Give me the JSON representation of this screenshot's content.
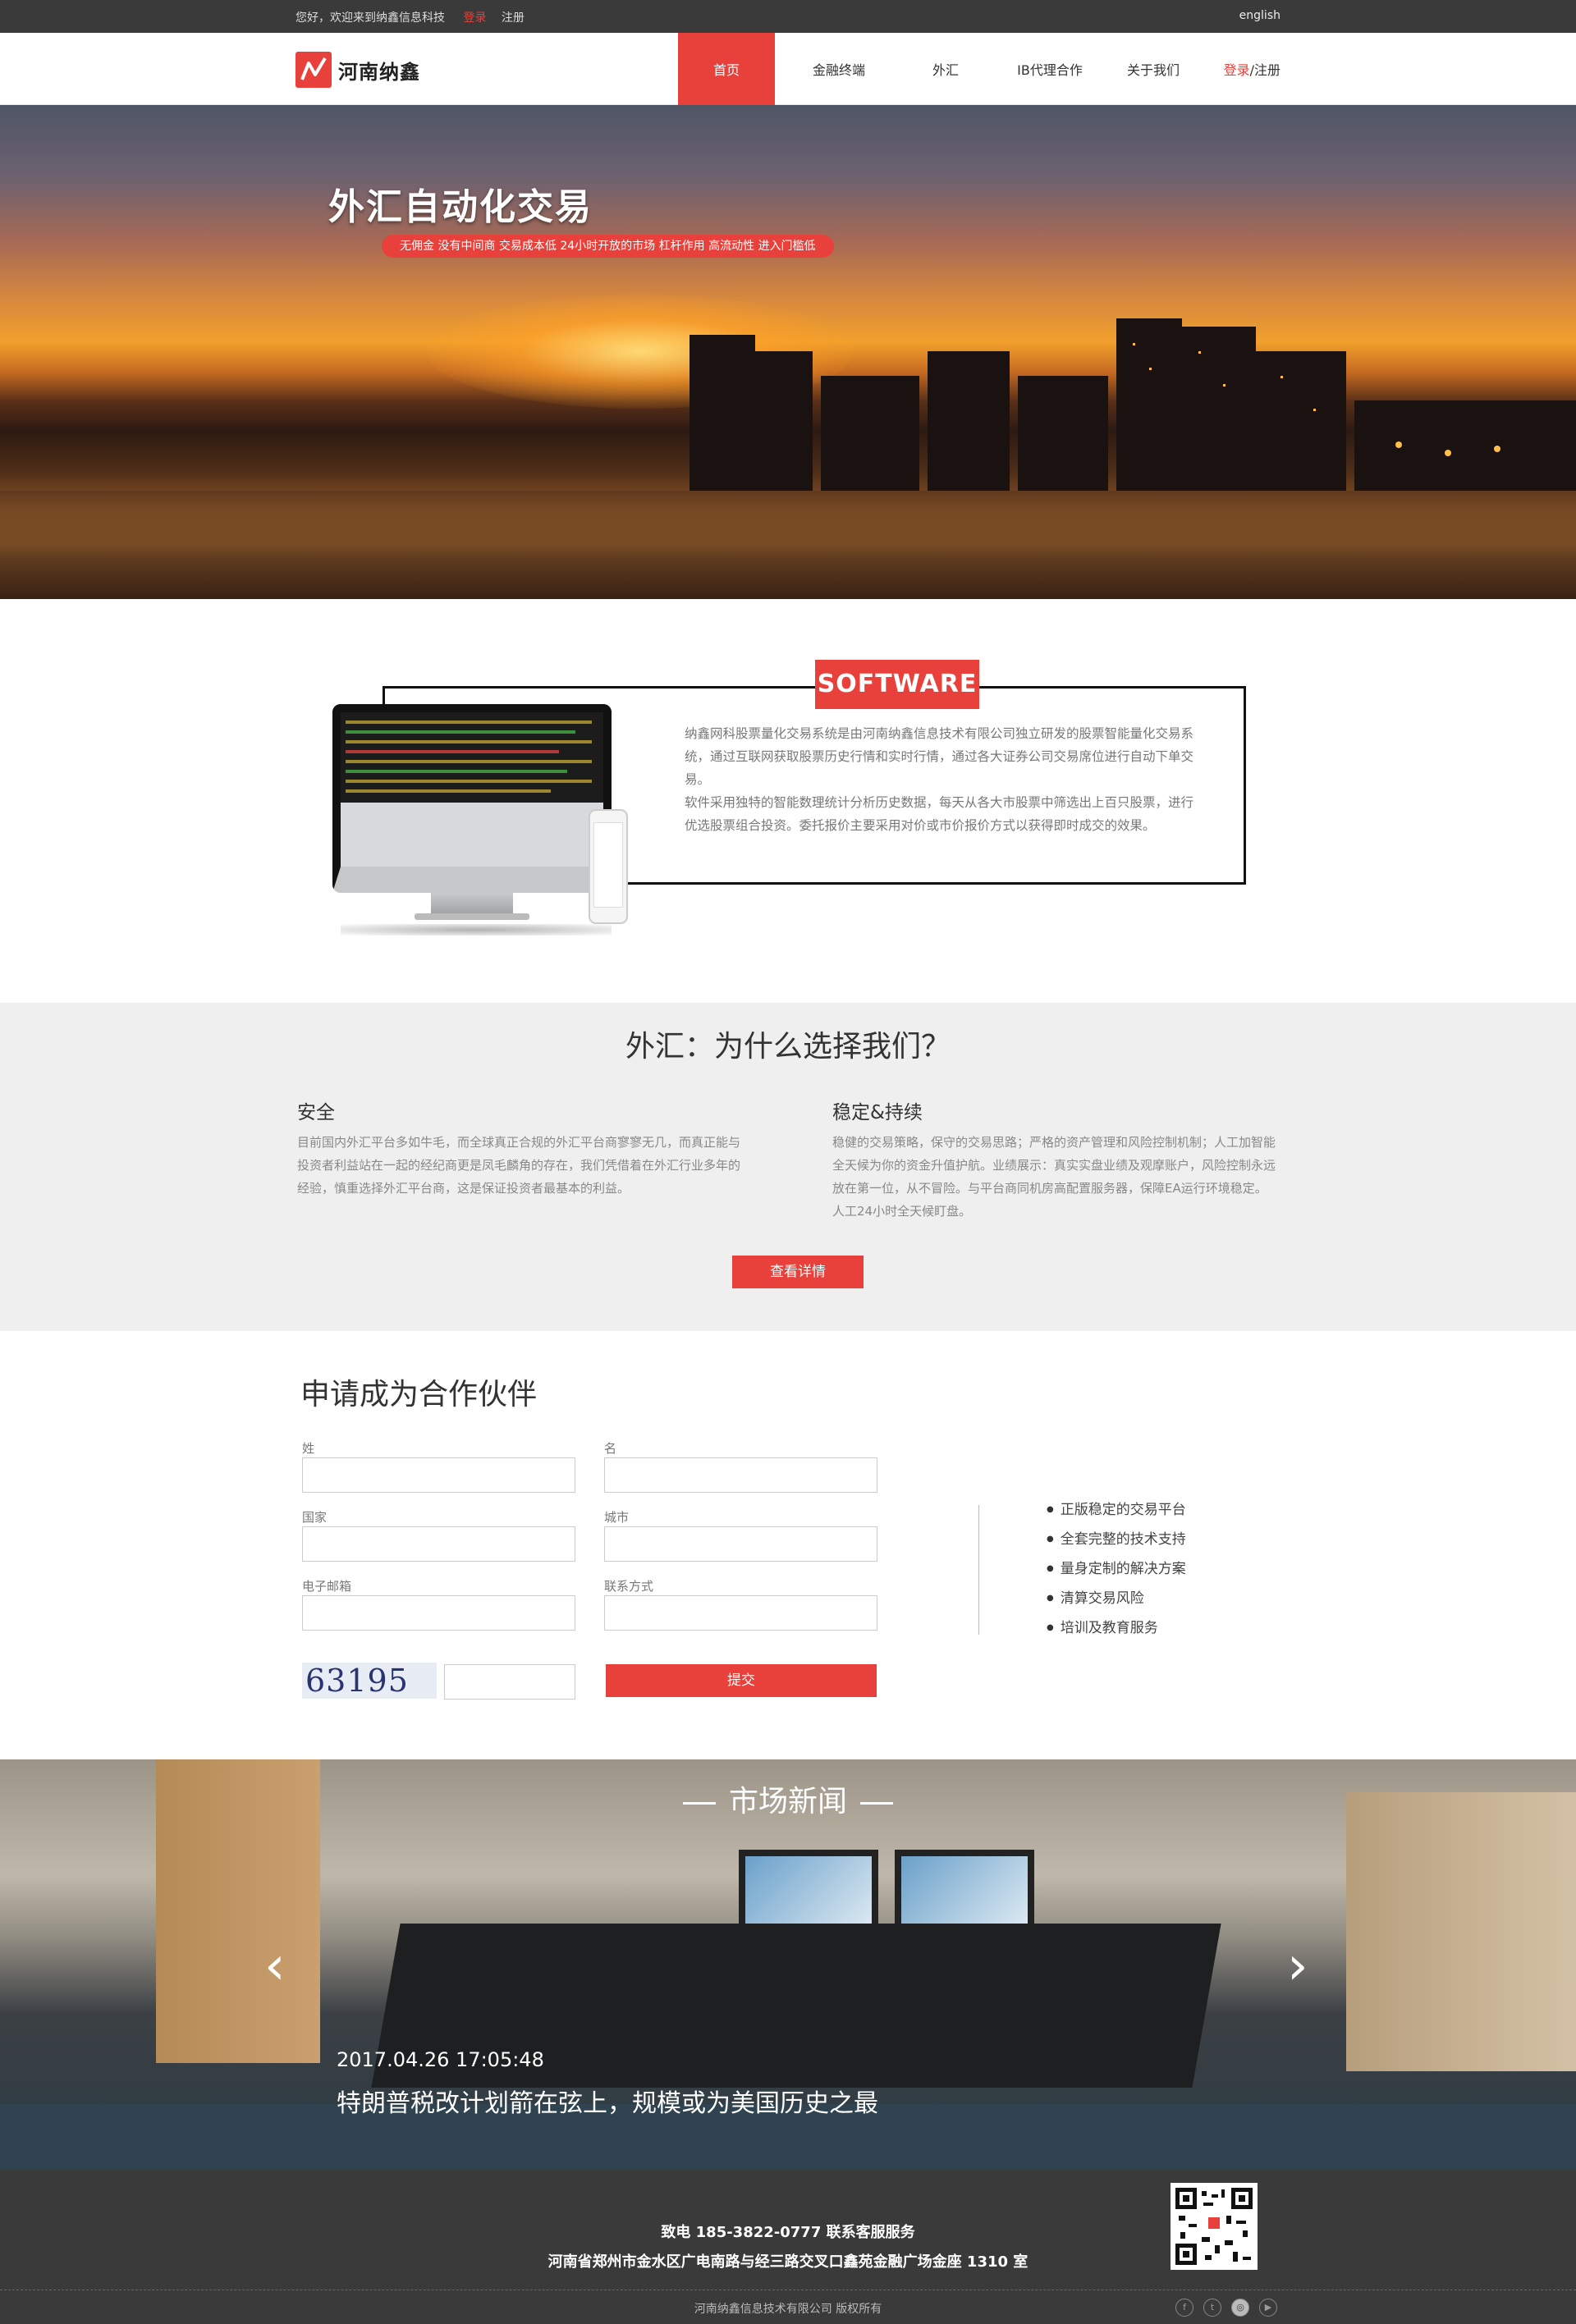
{
  "topbar": {
    "welcome": "您好，欢迎来到纳鑫信息科技",
    "login": "登录",
    "register": "注册",
    "language": "english"
  },
  "nav": {
    "logo_text": "河南纳鑫",
    "items": [
      {
        "label": "首页",
        "active": true
      },
      {
        "label": "金融终端"
      },
      {
        "label": "外汇"
      },
      {
        "label": "IB代理合作"
      },
      {
        "label": "关于我们"
      }
    ],
    "login": "登录",
    "separator": "/",
    "register": "注册"
  },
  "banner": {
    "title": "外汇自动化交易",
    "subtitle": "无佣金 没有中间商 交易成本低 24小时开放的市场 杠杆作用 高流动性 进入门槛低"
  },
  "software": {
    "tag": "SOFTWARE",
    "paragraph1": "纳鑫网科股票量化交易系统是由河南纳鑫信息技术有限公司独立研发的股票智能量化交易系统，通过互联网获取股票历史行情和实时行情，通过各大证券公司交易席位进行自动下单交易。",
    "paragraph2": "软件采用独特的智能数理统计分析历史数据，每天从各大市股票中筛选出上百只股票，进行优选股票组合投资。委托报价主要采用对价或市价报价方式以获得即时成交的效果。"
  },
  "why": {
    "title": "外汇：为什么选择我们？",
    "left": {
      "heading": "安全",
      "text": "目前国内外汇平台多如牛毛，而全球真正合规的外汇平台商寥寥无几，而真正能与投资者利益站在一起的经纪商更是凤毛麟角的存在，我们凭借着在外汇行业多年的经验，慎重选择外汇平台商，这是保证投资者最基本的利益。"
    },
    "right": {
      "heading": "稳定&持续",
      "text": "稳健的交易策略，保守的交易思路；严格的资产管理和风险控制机制；人工加智能全天候为你的资金升值护航。业绩展示：真实实盘业绩及观摩账户，风险控制永远放在第一位，从不冒险。与平台商同机房高配置服务器，保障EA运行环境稳定。人工24小时全天候盯盘。"
    },
    "button": "查看详情"
  },
  "partner": {
    "title": "申请成为合作伙伴",
    "fields": {
      "surname": "姓",
      "name": "名",
      "country": "国家",
      "city": "城市",
      "email": "电子邮箱",
      "contact": "联系方式"
    },
    "captcha": "63195",
    "submit": "提交",
    "benefits": [
      "正版稳定的交易平台",
      "全套完整的技术支持",
      "量身定制的解决方案",
      "清算交易风险",
      "培训及教育服务"
    ]
  },
  "news": {
    "title": "市场新闻",
    "date": "2017.04.26 17:05:48",
    "headline": "特朗普税改计划箭在弦上，规模或为美国历史之最",
    "prev": "‹",
    "next": "›"
  },
  "footer": {
    "phone_line": "致电 185-3822-0777 联系客服服务",
    "address_line": "河南省郑州市金水区广电南路与经三路交叉口鑫苑金融广场金座 1310 室",
    "copyright": "河南纳鑫信息技术有限公司 版权所有",
    "social_icons": [
      "facebook-icon",
      "twitter-icon",
      "instagram-icon",
      "youtube-icon"
    ]
  },
  "colors": {
    "accent": "#e8413b",
    "topbar": "#3a3a3a",
    "section_gray": "#efefef"
  }
}
